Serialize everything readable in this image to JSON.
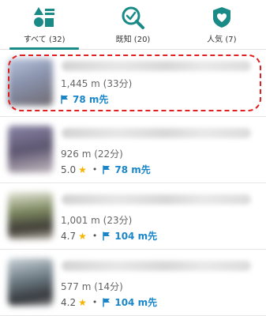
{
  "tabs": [
    {
      "label": "すべて (32)",
      "icon": "grid-shapes-icon",
      "active": true
    },
    {
      "label": "既知 (20)",
      "icon": "magnifier-check-icon",
      "active": false
    },
    {
      "label": "人気 (7)",
      "icon": "heart-badge-icon",
      "active": false
    }
  ],
  "colors": {
    "accent": "#1a8a86",
    "link": "#1a86c8",
    "star": "#f5b400",
    "highlight": "#e02020"
  },
  "items": [
    {
      "distance": "1,445 m (33分)",
      "rating": "",
      "ahead": "78 m先"
    },
    {
      "distance": "926 m (22分)",
      "rating": "5.0",
      "ahead": "78 m先"
    },
    {
      "distance": "1,001 m (23分)",
      "rating": "4.7",
      "ahead": "104 m先"
    },
    {
      "distance": "577 m (14分)",
      "rating": "4.2",
      "ahead": "104 m先"
    }
  ]
}
